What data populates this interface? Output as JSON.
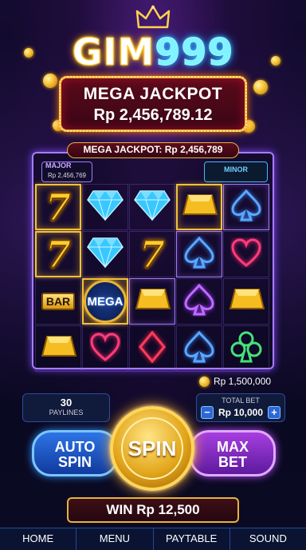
{
  "logo": {
    "part1": "GIM",
    "part2": "999"
  },
  "jackpot": {
    "title": "MEGA JACKPOT",
    "amount": "Rp 2,456,789.12"
  },
  "ticker": "MEGA JACKPOT: Rp 2,456,789",
  "major": {
    "label": "MAJOR",
    "value": "Rp 2,456,769"
  },
  "minor": {
    "label": "MINOR"
  },
  "reels": [
    [
      "seven",
      "seven",
      "bar",
      "gold"
    ],
    [
      "diamond",
      "diamond",
      "mega",
      "heart"
    ],
    [
      "diamond",
      "seven",
      "gold",
      "diamond-suit"
    ],
    [
      "gold",
      "spade",
      "spade",
      "spade"
    ],
    [
      "spade",
      "heart",
      "gold",
      "club"
    ]
  ],
  "symbol_text": {
    "bar": "BAR",
    "mega": "MEGA"
  },
  "balance": "Rp 1,500,000",
  "paylines": {
    "count": "30",
    "label": "PAYLINES"
  },
  "total_bet": {
    "label": "TOTAL BET",
    "value": "Rp 10,000",
    "minus": "−",
    "plus": "+"
  },
  "buttons": {
    "auto_line1": "AUTO",
    "auto_line2": "SPIN",
    "spin": "SPIN",
    "max_line1": "MAX",
    "max_line2": "BET"
  },
  "win": "WIN Rp 12,500",
  "nav": [
    "HOME",
    "MENU",
    "PAYTABLE",
    "SOUND"
  ]
}
